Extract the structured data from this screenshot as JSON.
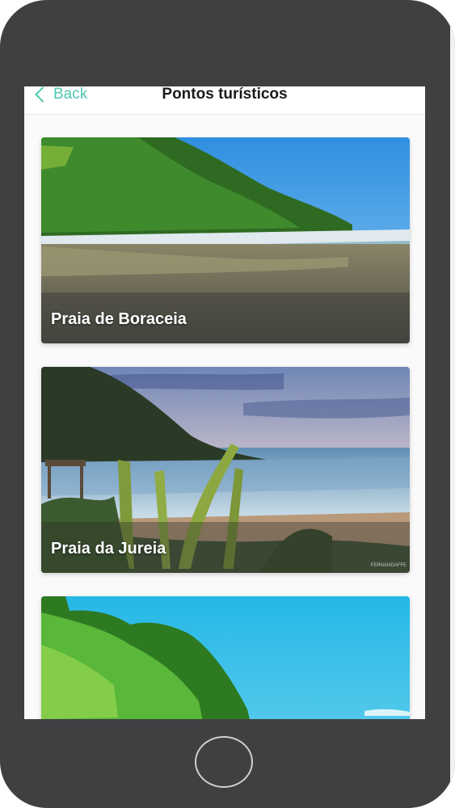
{
  "nav": {
    "back_label": "Back",
    "title": "Pontos turísticos"
  },
  "cards": [
    {
      "label": "Praia de Boraceia"
    },
    {
      "label": "Praia da Jureia",
      "watermark": "FERNANDAFFE"
    },
    {
      "label": ""
    }
  ],
  "colors": {
    "accent": "#4ec9b0",
    "device_frame": "#404042"
  },
  "icons": {
    "back": "chevron-left-icon",
    "home": "home-button-icon"
  }
}
